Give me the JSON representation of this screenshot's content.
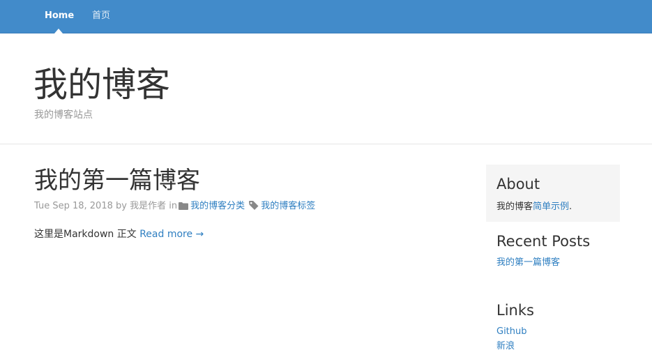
{
  "nav": {
    "home_label": "Home",
    "index_label": "首页"
  },
  "header": {
    "title": "我的博客",
    "subtitle": "我的博客站点"
  },
  "post": {
    "title": "我的第一篇博客",
    "date": "Tue Sep 18, 2018",
    "by_text": "by",
    "author": "我是作者",
    "in_text": "in",
    "category": "我的博客分类",
    "tag": "我的博客标签",
    "body_text": "这里是Markdown 正文",
    "read_more": "Read more →",
    "category_icon": "folder-icon",
    "tag_icon": "tag-icon"
  },
  "sidebar": {
    "about": {
      "heading": "About",
      "text_prefix": "我的博客",
      "link_text": "简单示例",
      "text_suffix": "."
    },
    "recent": {
      "heading": "Recent Posts",
      "items": [
        "我的第一篇博客"
      ]
    },
    "links": {
      "heading": "Links",
      "items": [
        "Github",
        "新浪"
      ]
    }
  },
  "colors": {
    "navbar": "#428bca",
    "link": "#2f7fc1",
    "muted": "#999999",
    "about_bg": "#f5f5f5"
  }
}
